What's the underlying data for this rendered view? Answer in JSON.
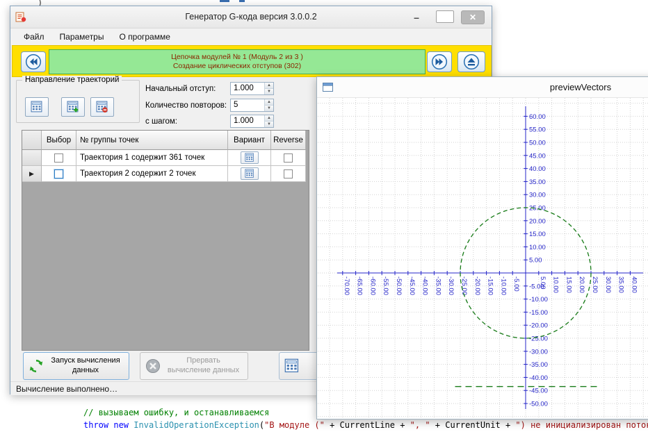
{
  "background": {
    "artifact_paren": ")",
    "code_comment": "// вызываем ошибку, и останавливаемся",
    "code_tokens": [
      {
        "text": "throw",
        "color": "#0000ff"
      },
      {
        "text": " ",
        "color": "#000000"
      },
      {
        "text": "new",
        "color": "#0000ff"
      },
      {
        "text": " ",
        "color": "#000000"
      },
      {
        "text": "InvalidOperationException",
        "color": "#2b91af"
      },
      {
        "text": "(",
        "color": "#000000"
      },
      {
        "text": "\"В модуле (\"",
        "color": "#a31515"
      },
      {
        "text": " + CurrentLine + ",
        "color": "#000000"
      },
      {
        "text": "\", \"",
        "color": "#a31515"
      },
      {
        "text": " + CurrentUnit + ",
        "color": "#000000"
      },
      {
        "text": "\") не инициализирован поток для",
        "color": "#a31515"
      }
    ]
  },
  "main_window": {
    "title": "Генератор G-кода версия 3.0.0.2",
    "menu": [
      {
        "label": "Файл"
      },
      {
        "label": "Параметры"
      },
      {
        "label": "О программе"
      }
    ],
    "module_bar": {
      "line1": "Цепочка модулей № 1 (Модуль 2 из 3 )",
      "line2": "Создание циклических отступов (302)"
    },
    "trajectory_group": {
      "title": "Направление траекторий"
    },
    "fields": [
      {
        "label": "Начальный отступ:",
        "value": "1.000"
      },
      {
        "label": "Количество повторов:",
        "value": "5"
      },
      {
        "label": "с шагом:",
        "value": "1.000"
      }
    ],
    "grid": {
      "columns": [
        "Выбор",
        "№ группы точек",
        "Вариант",
        "Reverse"
      ],
      "rows": [
        {
          "current": false,
          "checked": false,
          "name": "Траектория 1 содержит 361 точек",
          "reverse": false
        },
        {
          "current": true,
          "checked": false,
          "name": "Траектория 2 содержит 2 точек",
          "reverse": false
        }
      ]
    },
    "actions": {
      "run": "Запуск вычисления данных",
      "abort": "Прервать вычисление данных"
    },
    "status": "Вычисление выполнено…"
  },
  "preview_window": {
    "title": "previewVectors",
    "chart_data": {
      "type": "line",
      "tick_step": 5,
      "x_range": [
        -79,
        46
      ],
      "y_range": [
        -56,
        67
      ],
      "grid": "dotted",
      "colors": {
        "axis": "#2424c8",
        "grid": "#d2d2d2",
        "trace": "#167a16"
      },
      "y_ticks": [
        {
          "v": 60,
          "label": "60.00"
        },
        {
          "v": 55,
          "label": "55.00"
        },
        {
          "v": 50,
          "label": "50.00"
        },
        {
          "v": 45,
          "label": "45.00"
        },
        {
          "v": 40,
          "label": "40.00"
        },
        {
          "v": 35,
          "label": "35.00"
        },
        {
          "v": 30,
          "label": "30.00"
        },
        {
          "v": 25,
          "label": "25.00"
        },
        {
          "v": 20,
          "label": "20.00"
        },
        {
          "v": 15,
          "label": "15.00"
        },
        {
          "v": 10,
          "label": "10.00"
        },
        {
          "v": 5,
          "label": "5.00"
        },
        {
          "v": -5,
          "label": "-5.00"
        },
        {
          "v": -10,
          "label": "-10.00"
        },
        {
          "v": -15,
          "label": "-15.00"
        },
        {
          "v": -20,
          "label": "-20.00"
        },
        {
          "v": -25,
          "label": "-25.00"
        },
        {
          "v": -30,
          "label": "-30.00"
        },
        {
          "v": -35,
          "label": "-35.00"
        },
        {
          "v": -40,
          "label": "-40.00"
        },
        {
          "v": -45,
          "label": "-45.00"
        },
        {
          "v": -50,
          "label": "-50.00"
        }
      ],
      "x_ticks": [
        {
          "v": -70,
          "label": "-70.00"
        },
        {
          "v": -65,
          "label": "-65.00"
        },
        {
          "v": -60,
          "label": "-60.00"
        },
        {
          "v": -55,
          "label": "-55.00"
        },
        {
          "v": -50,
          "label": "-50.00"
        },
        {
          "v": -45,
          "label": "-45.00"
        },
        {
          "v": -40,
          "label": "-40.00"
        },
        {
          "v": -35,
          "label": "-35.00"
        },
        {
          "v": -30,
          "label": "-30.00"
        },
        {
          "v": -25,
          "label": "-25.00"
        },
        {
          "v": -20,
          "label": "-20.00"
        },
        {
          "v": -15,
          "label": "-15.00"
        },
        {
          "v": -10,
          "label": "-10.00"
        },
        {
          "v": -5,
          "label": "-5.00"
        },
        {
          "v": 5,
          "label": "5.00"
        },
        {
          "v": 10,
          "label": "10.00"
        },
        {
          "v": 15,
          "label": "15.00"
        },
        {
          "v": 20,
          "label": "20.00"
        },
        {
          "v": 25,
          "label": "25.00"
        },
        {
          "v": 30,
          "label": "30.00"
        },
        {
          "v": 35,
          "label": "35.00"
        },
        {
          "v": 40,
          "label": "40.00"
        }
      ],
      "series": [
        {
          "shape": "circle",
          "cx": 0,
          "cy": 0,
          "r": 25,
          "point_count": 361
        },
        {
          "shape": "segment",
          "points": [
            [
              -27,
              -43.5
            ],
            [
              27.5,
              -43.5
            ]
          ],
          "point_count": 2
        }
      ]
    }
  }
}
